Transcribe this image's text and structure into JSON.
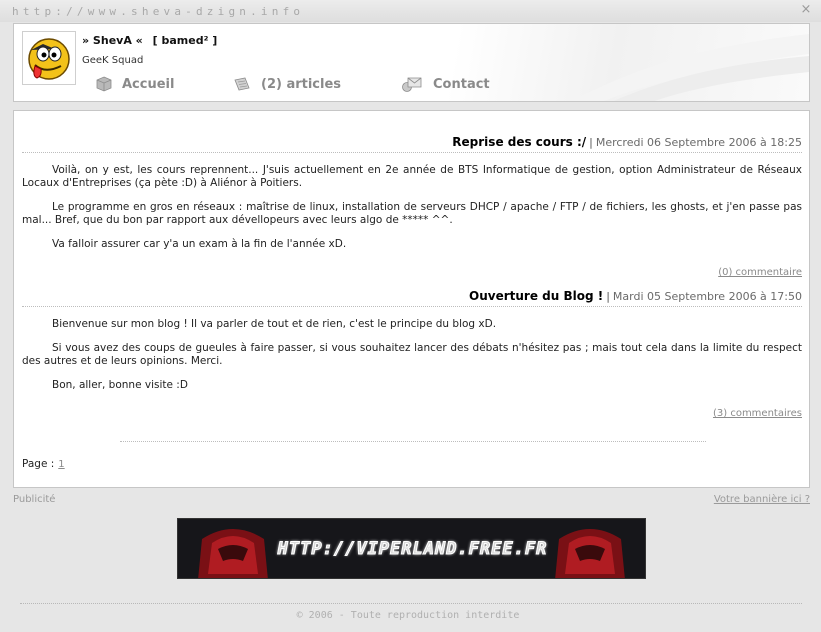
{
  "site": {
    "url_text": "http://www.sheva-dzign.info",
    "close_glyph": "×"
  },
  "header": {
    "name_prefix": "» ShevA «",
    "team": "[ bamed² ]",
    "tagline": "GeeK Squad",
    "avatar_icon": "smiley-tongue-avatar"
  },
  "nav": [
    {
      "label": "Accueil",
      "icon": "box-icon"
    },
    {
      "label": "(2) articles",
      "icon": "notepad-icon"
    },
    {
      "label": "Contact",
      "icon": "mail-icon"
    }
  ],
  "posts": [
    {
      "title": "Reprise des cours :/",
      "separator": "|",
      "date": "Mercredi 06 Septembre 2006 à 18:25",
      "paragraphs": [
        "Voilà, on y est, les cours reprennent... J'suis actuellement en 2e année de BTS Informatique de gestion, option Administrateur de Réseaux Locaux d'Entreprises (ça pète :D) à Aliénor à Poitiers.",
        "Le programme en gros en réseaux : maîtrise de linux, installation de serveurs DHCP / apache / FTP / de fichiers, les ghosts, et j'en passe pas mal... Bref, que du bon par rapport aux dévellopeurs avec leurs algo de ***** ^^.",
        "Va falloir assurer car y'a un exam à la fin de l'année xD."
      ],
      "comments": "(0) commentaire"
    },
    {
      "title": "Ouverture du Blog !",
      "separator": "|",
      "date": "Mardi 05 Septembre 2006 à 17:50",
      "paragraphs": [
        "Bienvenue sur mon blog ! Il va parler de tout et de rien, c'est le principe du blog xD.",
        "Si vous avez des coups de gueules à faire passer, si vous souhaitez lancer des débats n'hésitez pas ; mais tout cela dans la limite du respect des autres et de leurs opinions. Merci.",
        "Bon, aller, bonne visite :D"
      ],
      "comments": "(3) commentaires"
    }
  ],
  "pager": {
    "label": "Page :",
    "current": "1"
  },
  "ads": {
    "label": "Publicité",
    "link": "Votre bannière ici ?",
    "banner_text": "HTTP://VIPERLAND.FREE.FR",
    "banner_icon": "viper-head-icon"
  },
  "footer": {
    "copyright": "© 2006 - Toute reproduction interdite"
  },
  "colors": {
    "page_background": "#e6e6e6",
    "panel_background": "#ffffff",
    "muted_text": "#8a8a8a",
    "banner_background": "#16161a",
    "banner_accent": "#b01c22"
  }
}
